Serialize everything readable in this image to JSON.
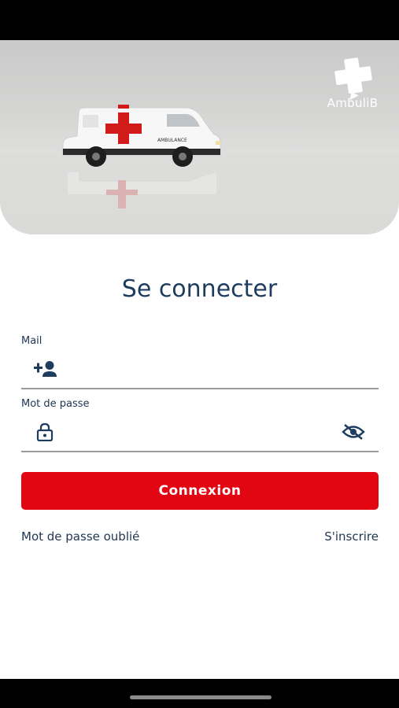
{
  "brand": {
    "name": "AmbuliB",
    "logo_icon": "ambulib-cross-logo"
  },
  "hero": {
    "image": "toy-ambulance-photo",
    "vehicle_text": "AMBULANCE"
  },
  "login": {
    "title": "Se connecter",
    "mail_label": "Mail",
    "mail_value": "",
    "mail_icon": "person-add-icon",
    "password_label": "Mot de passe",
    "password_value": "",
    "password_icon": "lock-icon",
    "visibility_icon": "eye-off-icon",
    "submit_label": "Connexion",
    "forgot_link": "Mot de passe oublié",
    "signup_link": "S'inscrire"
  },
  "colors": {
    "primary": "#1d3c5e",
    "accent": "#e20613",
    "divider": "#9a9a9a"
  }
}
